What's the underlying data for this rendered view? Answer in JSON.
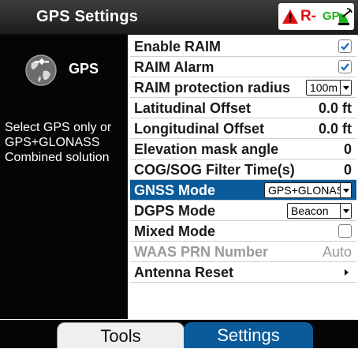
{
  "title": "GPS Settings",
  "status": {
    "alarm_icon": "warning-triangle-icon",
    "alarm_color": "#e01010",
    "r_indicator": "R-",
    "gp_indicator": "GP",
    "gp_color": "#20b020",
    "satellite_icon": "satellite-dish-icon"
  },
  "left": {
    "icon": "globe-satellite-icon",
    "label": "GPS",
    "description": "Select GPS only or\nGPS+GLONASS\nCombined solution"
  },
  "settings": [
    {
      "label": "Enable RAIM",
      "control": "checkbox",
      "checked": true
    },
    {
      "label": "RAIM Alarm",
      "control": "checkbox",
      "checked": true
    },
    {
      "label": "RAIM protection radius",
      "control": "dropdown",
      "value": "100m"
    },
    {
      "label": "Latitudinal Offset",
      "control": "value",
      "value": "0.0 ft"
    },
    {
      "label": "Longitudinal Offset",
      "control": "value",
      "value": "0.0 ft"
    },
    {
      "label": "Elevation mask angle",
      "control": "value",
      "value": "0"
    },
    {
      "label": "COG/SOG Filter Time(s)",
      "control": "value",
      "value": "0"
    },
    {
      "label": "GNSS Mode",
      "control": "dropdown",
      "value": "GPS+GLONASS",
      "selected": true
    },
    {
      "label": "DGPS Mode",
      "control": "dropdown",
      "value": "Beacon"
    },
    {
      "label": "Mixed Mode",
      "control": "checkbox",
      "checked": false
    },
    {
      "label": "WAAS PRN Number",
      "control": "value",
      "value": "Auto",
      "disabled": true
    },
    {
      "label": "Antenna Reset",
      "control": "submenu"
    }
  ],
  "tabs": [
    {
      "label": "Tools",
      "active": false
    },
    {
      "label": "Settings",
      "active": true
    }
  ],
  "colors": {
    "accent": "#0b5b9a",
    "panel": "#050505",
    "check": "#1a6fc0"
  }
}
